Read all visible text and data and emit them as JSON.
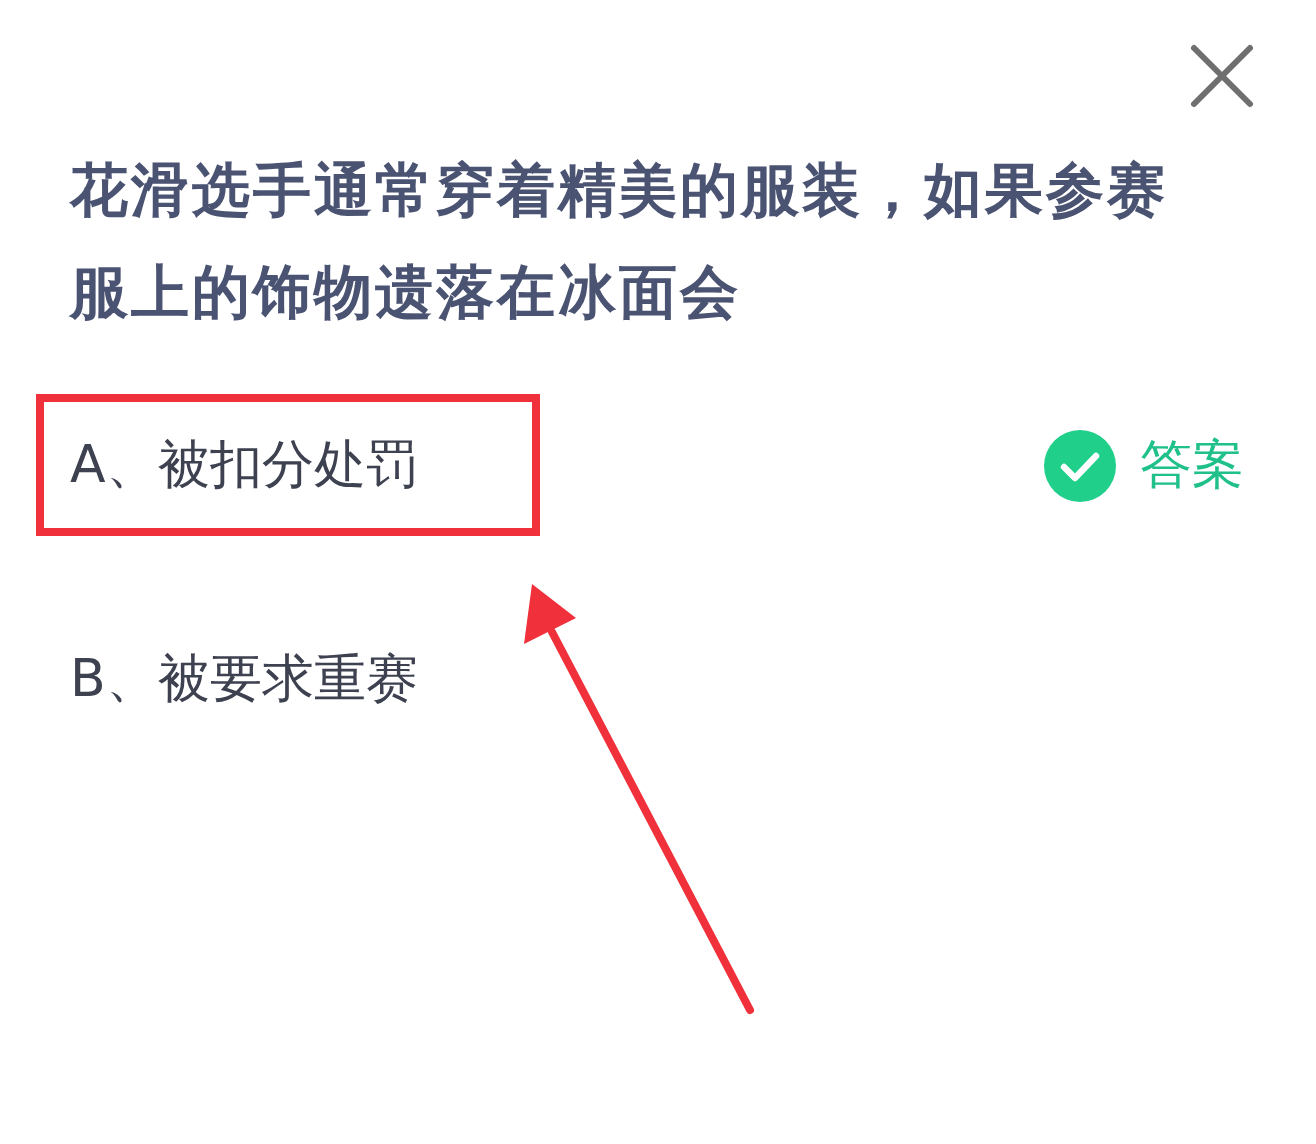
{
  "question": "花滑选手通常穿着精美的服装，如果参赛服上的饰物遗落在冰面会",
  "options": [
    {
      "text": "A、被扣分处罚",
      "correct": true,
      "answer_label": "答案",
      "highlighted": true
    },
    {
      "text": "B、被要求重赛",
      "correct": false,
      "highlighted": false
    }
  ],
  "annotation_arrow": true
}
